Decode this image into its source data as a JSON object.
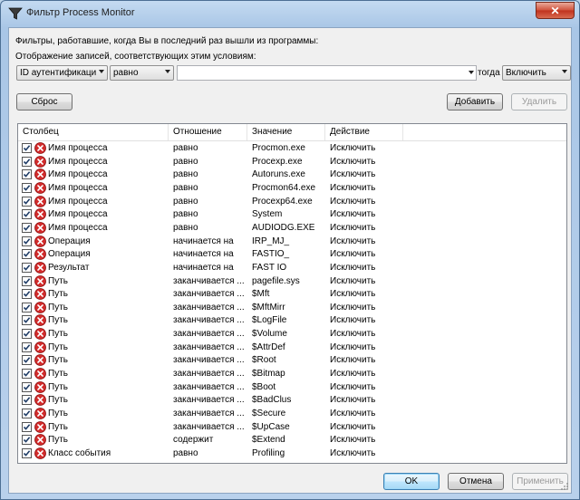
{
  "window": {
    "title": "Фильтр Process Monitor"
  },
  "instructions": {
    "line1": "Фильтры, работавшие, когда Вы в последний раз вышли из программы:",
    "line2": "Отображение записей, соответствующих этим условиям:"
  },
  "filter_bar": {
    "column": "ID аутентификаци",
    "relation": "равно",
    "value": "",
    "then_label": "тогда",
    "action": "Включить"
  },
  "buttons": {
    "reset": "Сброс",
    "add": "Добавить",
    "remove": "Удалить",
    "ok": "OK",
    "cancel": "Отмена",
    "apply": "Применить"
  },
  "table": {
    "columns": [
      "Столбец",
      "Отношение",
      "Значение",
      "Действие"
    ],
    "rows": [
      {
        "column": "Имя процесса",
        "relation": "равно",
        "value": "Procmon.exe",
        "action": "Исключить"
      },
      {
        "column": "Имя процесса",
        "relation": "равно",
        "value": "Procexp.exe",
        "action": "Исключить"
      },
      {
        "column": "Имя процесса",
        "relation": "равно",
        "value": "Autoruns.exe",
        "action": "Исключить"
      },
      {
        "column": "Имя процесса",
        "relation": "равно",
        "value": "Procmon64.exe",
        "action": "Исключить"
      },
      {
        "column": "Имя процесса",
        "relation": "равно",
        "value": "Procexp64.exe",
        "action": "Исключить"
      },
      {
        "column": "Имя процесса",
        "relation": "равно",
        "value": "System",
        "action": "Исключить"
      },
      {
        "column": "Имя процесса",
        "relation": "равно",
        "value": "AUDIODG.EXE",
        "action": "Исключить"
      },
      {
        "column": "Операция",
        "relation": "начинается на",
        "value": "IRP_MJ_",
        "action": "Исключить"
      },
      {
        "column": "Операция",
        "relation": "начинается на",
        "value": "FASTIO_",
        "action": "Исключить"
      },
      {
        "column": "Результат",
        "relation": "начинается на",
        "value": "FAST IO",
        "action": "Исключить"
      },
      {
        "column": "Путь",
        "relation": "заканчивается ...",
        "value": "pagefile.sys",
        "action": "Исключить"
      },
      {
        "column": "Путь",
        "relation": "заканчивается ...",
        "value": "$Mft",
        "action": "Исключить"
      },
      {
        "column": "Путь",
        "relation": "заканчивается ...",
        "value": "$MftMirr",
        "action": "Исключить"
      },
      {
        "column": "Путь",
        "relation": "заканчивается ...",
        "value": "$LogFile",
        "action": "Исключить"
      },
      {
        "column": "Путь",
        "relation": "заканчивается ...",
        "value": "$Volume",
        "action": "Исключить"
      },
      {
        "column": "Путь",
        "relation": "заканчивается ...",
        "value": "$AttrDef",
        "action": "Исключить"
      },
      {
        "column": "Путь",
        "relation": "заканчивается ...",
        "value": "$Root",
        "action": "Исключить"
      },
      {
        "column": "Путь",
        "relation": "заканчивается ...",
        "value": "$Bitmap",
        "action": "Исключить"
      },
      {
        "column": "Путь",
        "relation": "заканчивается ...",
        "value": "$Boot",
        "action": "Исключить"
      },
      {
        "column": "Путь",
        "relation": "заканчивается ...",
        "value": "$BadClus",
        "action": "Исключить"
      },
      {
        "column": "Путь",
        "relation": "заканчивается ...",
        "value": "$Secure",
        "action": "Исключить"
      },
      {
        "column": "Путь",
        "relation": "заканчивается ...",
        "value": "$UpCase",
        "action": "Исключить"
      },
      {
        "column": "Путь",
        "relation": "содержит",
        "value": "$Extend",
        "action": "Исключить"
      },
      {
        "column": "Класс события",
        "relation": "равно",
        "value": "Profiling",
        "action": "Исключить"
      }
    ]
  }
}
